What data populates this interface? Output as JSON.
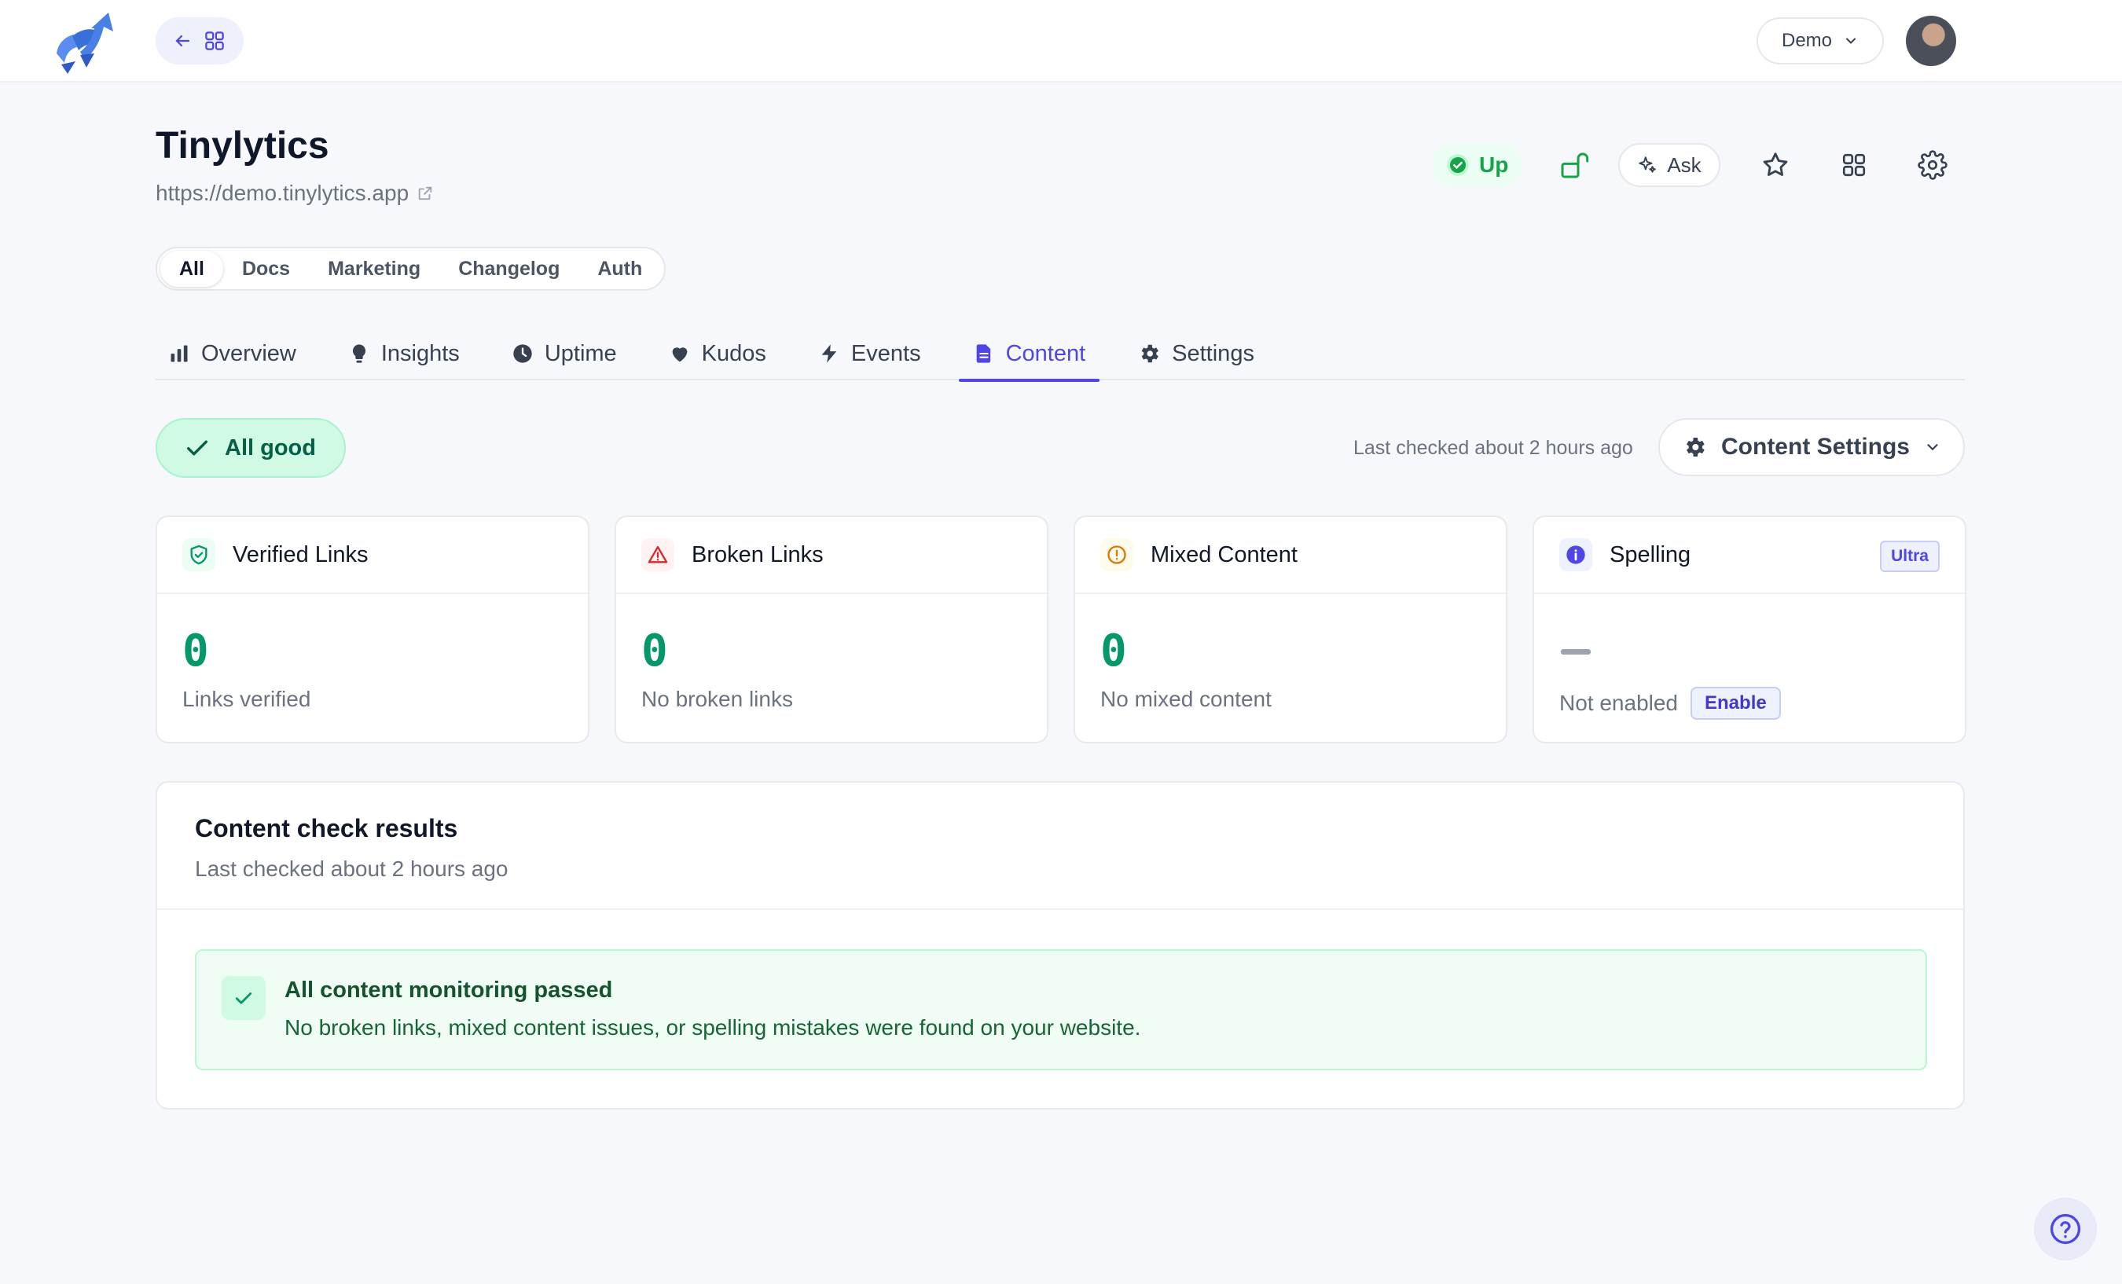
{
  "app": {
    "brand_color": "#4f46e5",
    "success_color": "#059669"
  },
  "topbar": {
    "workspace": "Demo"
  },
  "site": {
    "name": "Tinylytics",
    "url": "https://demo.tinylytics.app"
  },
  "header_actions": {
    "status": "Up",
    "ask_label": "Ask"
  },
  "filters": [
    "All",
    "Docs",
    "Marketing",
    "Changelog",
    "Auth"
  ],
  "tabs": [
    {
      "label": "Overview",
      "icon": "bar-chart-icon"
    },
    {
      "label": "Insights",
      "icon": "lightbulb-icon"
    },
    {
      "label": "Uptime",
      "icon": "clock-icon"
    },
    {
      "label": "Kudos",
      "icon": "heart-icon"
    },
    {
      "label": "Events",
      "icon": "bolt-icon"
    },
    {
      "label": "Content",
      "icon": "document-icon"
    },
    {
      "label": "Settings",
      "icon": "gear-icon"
    }
  ],
  "status_row": {
    "status": "All good",
    "last_checked": "Last checked about 2 hours ago",
    "settings_label": "Content Settings"
  },
  "cards": [
    {
      "title": "Verified Links",
      "value": "0",
      "label": "Links verified"
    },
    {
      "title": "Broken Links",
      "value": "0",
      "label": "No broken links"
    },
    {
      "title": "Mixed Content",
      "value": "0",
      "label": "No mixed content"
    },
    {
      "title": "Spelling",
      "badge": "Ultra",
      "value": "—",
      "label": "Not enabled",
      "action": "Enable"
    }
  ],
  "results": {
    "title": "Content check results",
    "subtitle": "Last checked about 2 hours ago",
    "passed_title": "All content monitoring passed",
    "passed_desc": "No broken links, mixed content issues, or spelling mistakes were found on your website."
  }
}
